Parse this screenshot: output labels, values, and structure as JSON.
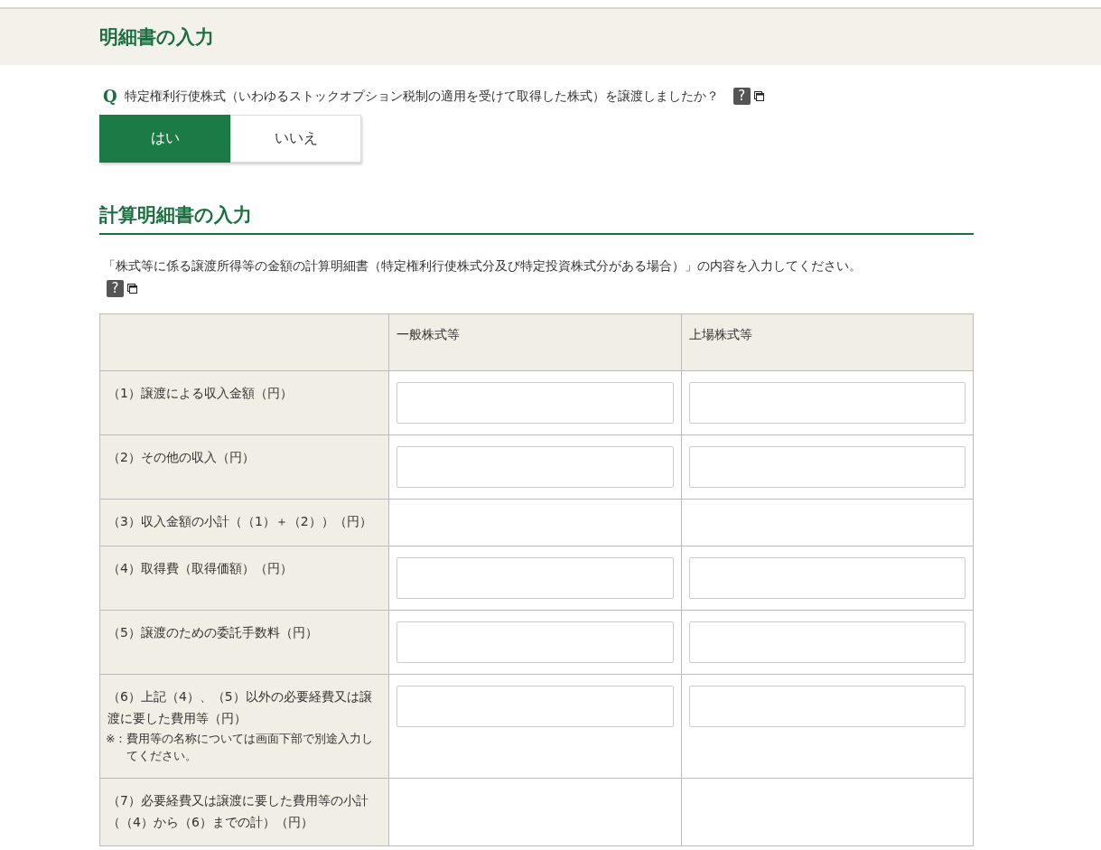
{
  "header": {
    "title": "明細書の入力"
  },
  "question": {
    "marker": "Q",
    "text": "特定権利行使株式（いわゆるストックオプション税制の適用を受けて取得した株式）を譲渡しましたか？",
    "help": "?"
  },
  "answer_options": [
    {
      "label": "はい",
      "selected": true
    },
    {
      "label": "いいえ",
      "selected": false
    }
  ],
  "section": {
    "title": "計算明細書の入力",
    "description": "「株式等に係る譲渡所得等の金額の計算明細書（特定権利行使株式分及び特定投資株式分がある場合）」の内容を入力してください。",
    "help": "?"
  },
  "table": {
    "columns": [
      "一般株式等",
      "上場株式等"
    ],
    "rows": [
      {
        "label": "（1）譲渡による収入金額（円）",
        "kind": "input"
      },
      {
        "label": "（2）その他の収入（円）",
        "kind": "input"
      },
      {
        "label": "（3）収入金額の小計（（1）＋（2））（円）",
        "kind": "computed"
      },
      {
        "label": "（4）取得費（取得価額）（円）",
        "kind": "input"
      },
      {
        "label": "（5）譲渡のための委託手数料（円）",
        "kind": "input"
      },
      {
        "label": "（6）上記（4）、（5）以外の必要経費又は譲渡に要した費用等（円）",
        "note_mark": "※：",
        "note": "費用等の名称については画面下部で別途入力してください。",
        "kind": "input"
      },
      {
        "label": "（7）必要経費又は譲渡に要した費用等の小計（（4）から（6）までの計）（円）",
        "kind": "computed"
      }
    ]
  }
}
